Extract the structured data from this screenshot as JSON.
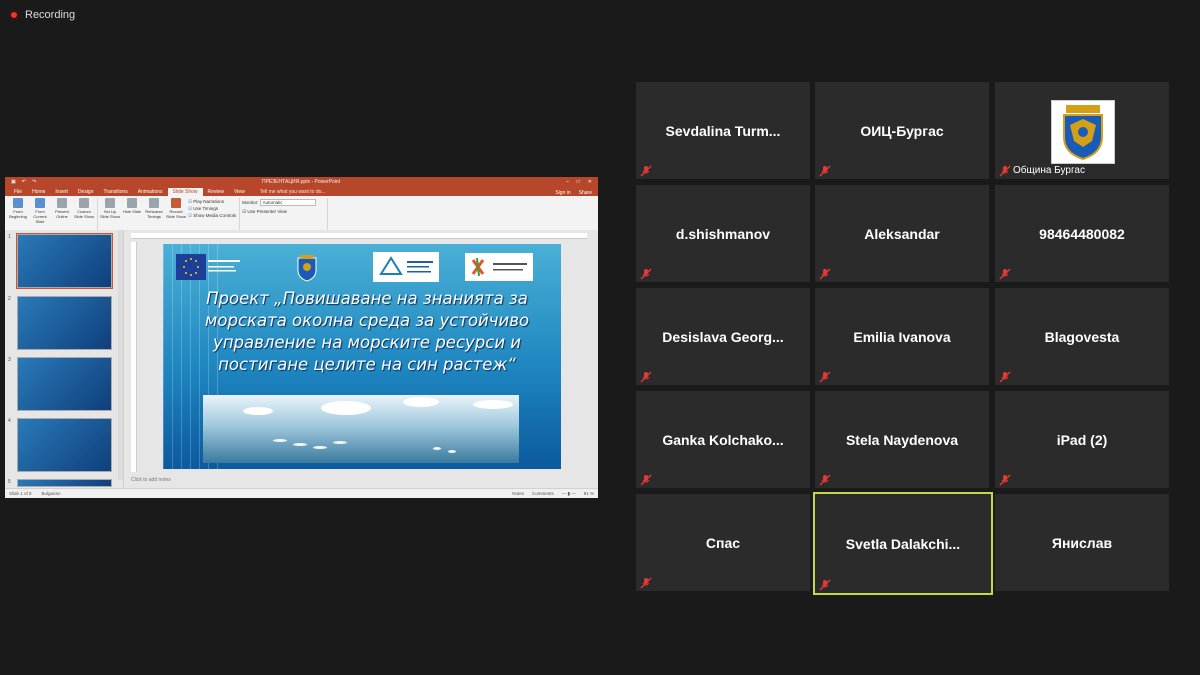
{
  "recording": {
    "label": "Recording"
  },
  "powerpoint": {
    "title_bar": {
      "doc_title": "ПРЕЗЕНТАЦИЯ.pptx - PowerPoint"
    },
    "tabs": [
      "File",
      "Home",
      "Insert",
      "Design",
      "Transitions",
      "Animations",
      "Slide Show",
      "Review",
      "View"
    ],
    "active_tab": "Slide Show",
    "tell_me": "Tell me what you want to do...",
    "sign_in": "Sign in",
    "share": "Share",
    "ribbon": {
      "buttons": [
        "From Beginning",
        "From Current Slide",
        "Present Online",
        "Custom Slide Show",
        "Set Up Slide Show",
        "Hide Slide",
        "Rehearse Timings",
        "Record Slide Show"
      ],
      "checks": [
        "Play Narrations",
        "Use Timings",
        "Show Media Controls"
      ],
      "monitor_label": "Monitor:",
      "monitor_value": "Automatic",
      "presenter_view": "Use Presenter View",
      "group_start": "Start Slide Show",
      "group_setup": "Set Up",
      "group_monitors": "Monitors"
    },
    "slide_numbers": [
      "1",
      "2",
      "3",
      "4",
      "5"
    ],
    "slide": {
      "title": "Проект „Повишаване на знанията за морската околна среда за устойчиво управление на морските ресурси и постигане целите на син растеж“"
    },
    "notes_placeholder": "Click to add notes",
    "status": {
      "slide": "Slide 1 of 8",
      "language": "Bulgarian",
      "notes": "Notes",
      "comments": "Comments",
      "zoom": "91 %"
    }
  },
  "participants": [
    {
      "name": "Sevdalina  Turm...",
      "muted": true
    },
    {
      "name": "ОИЦ-Бургас",
      "muted": true
    },
    {
      "name": "Община Бургас",
      "muted": true,
      "has_avatar": true
    },
    {
      "name": "d.shishmanov",
      "muted": true
    },
    {
      "name": "Aleksandar",
      "muted": true
    },
    {
      "name": "98464480082",
      "muted": true
    },
    {
      "name": "Desislava  Georg...",
      "muted": true
    },
    {
      "name": "Emilia Ivanova",
      "muted": true
    },
    {
      "name": "Blagovesta",
      "muted": true
    },
    {
      "name": "Ganka  Kolchako...",
      "muted": true
    },
    {
      "name": "Stela Naydenova",
      "muted": true
    },
    {
      "name": "iPad (2)",
      "muted": true
    },
    {
      "name": "Спас",
      "muted": true
    },
    {
      "name": "Svetla  Dalakchi...",
      "muted": true,
      "active_speaker": true
    },
    {
      "name": "Янислав",
      "muted": false
    }
  ],
  "colors": {
    "active_speaker_border": "#c7d64f",
    "muted_icon": "#e53935",
    "ppt_accent": "#b7472a"
  }
}
